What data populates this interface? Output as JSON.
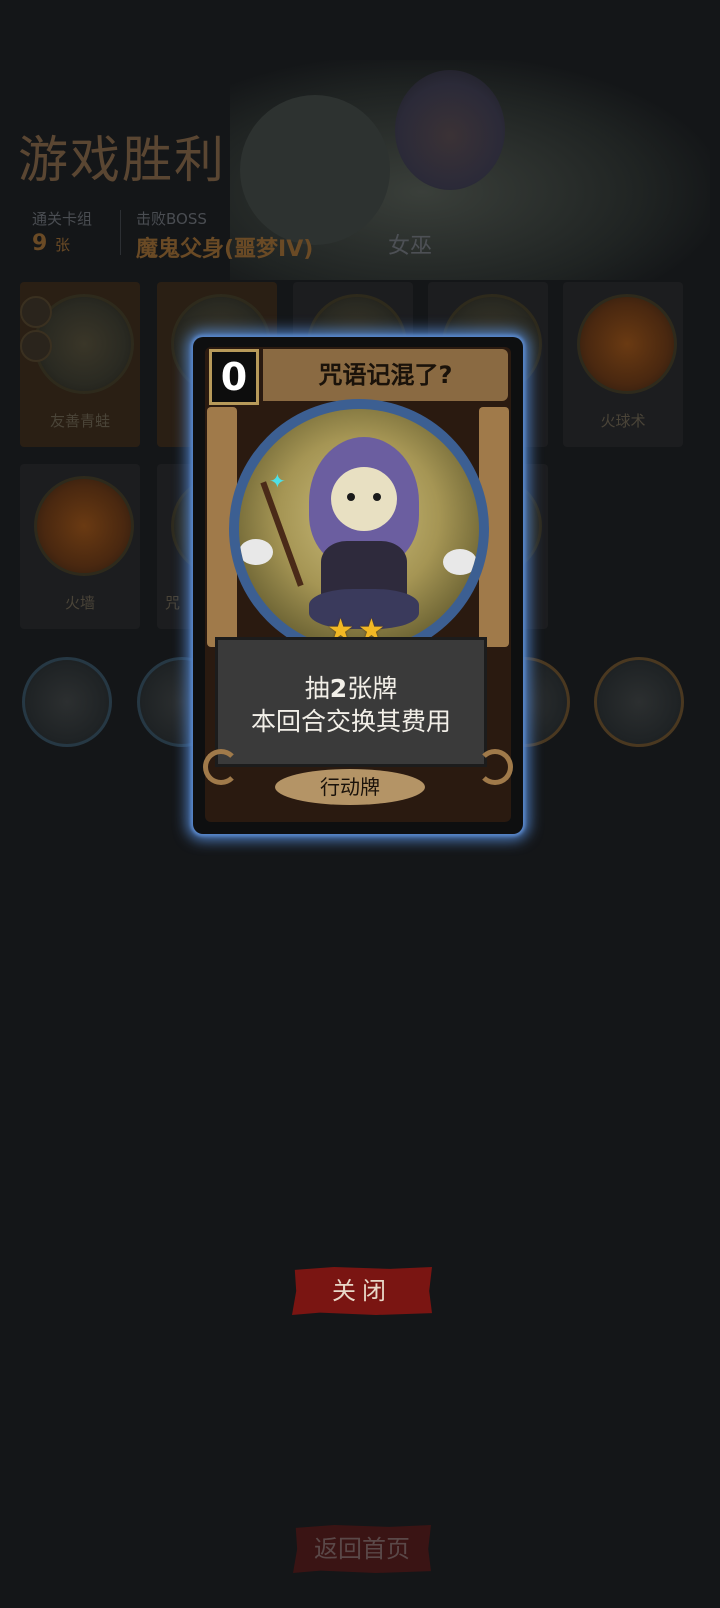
{
  "victory": {
    "title": "游戏胜利",
    "deck_label": "通关卡组",
    "deck_count": "9",
    "deck_unit": "张",
    "boss_label": "击败BOSS",
    "boss_name": "魔鬼父身(噩梦IV)",
    "hero_name": "女巫"
  },
  "deck_cards": [
    {
      "name": "友善青蛙"
    },
    {
      "name": ""
    },
    {
      "name": ""
    },
    {
      "name": ""
    },
    {
      "name": "火球术"
    },
    {
      "name": "火墙"
    },
    {
      "name": "咒"
    }
  ],
  "card_detail": {
    "cost": "0",
    "title": "咒语记混了?",
    "stars": "★★",
    "desc_prefix": "抽",
    "desc_count": "2",
    "desc_line1_suffix": "张牌",
    "desc_line2": "本回合交换其费用",
    "type": "行动牌"
  },
  "buttons": {
    "close": "关闭",
    "home": "返回首页"
  },
  "colors": {
    "card_glow": "#4f7fc4",
    "close_button": "#7a1512",
    "star": "#f2b824"
  }
}
